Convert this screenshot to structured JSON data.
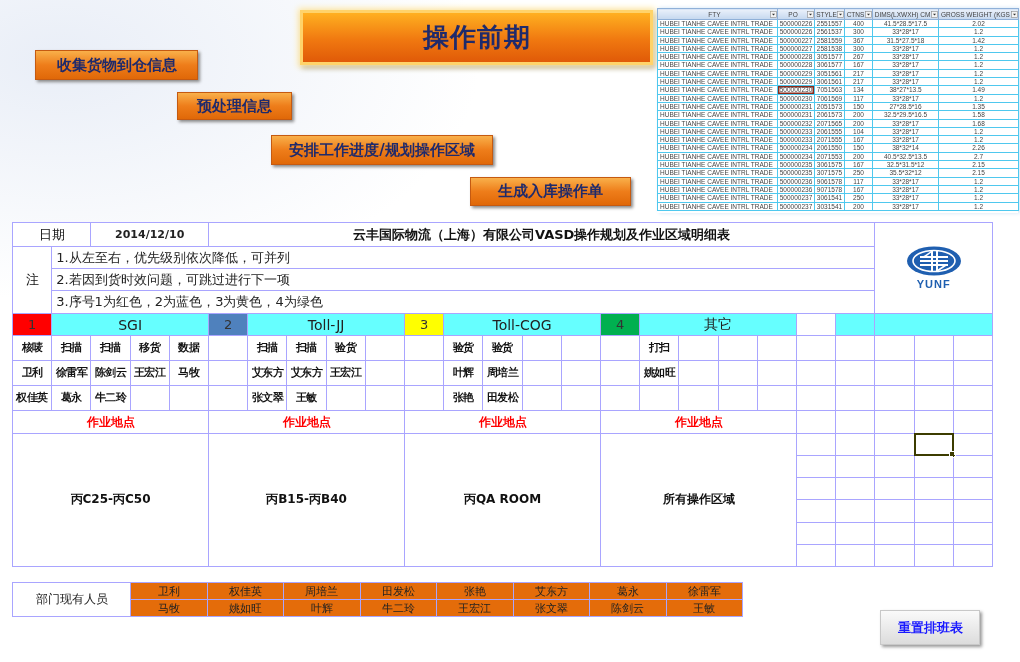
{
  "title_banner": "操作前期",
  "action_buttons": [
    "收集货物到仓信息",
    "预处理信息",
    "安排工作进度/规划操作区域",
    "生成入库操作单"
  ],
  "shipment_table": {
    "columns": [
      "FTY",
      "PO",
      "STYLE",
      "CTNS",
      "DIMS(LXWXH) CM",
      "GROSS WEIGHT (KGS"
    ],
    "rows": [
      {
        "cells": [
          "HUBEI TIANHE CAVEE INTRL TRADE",
          "500000226",
          "2551557",
          "400",
          "41.5*28.5*17.5",
          "2.02"
        ],
        "po_selected": false
      },
      {
        "cells": [
          "HUBEI TIANHE CAVEE INTRL TRADE",
          "500000226",
          "2561537",
          "300",
          "33*28*17",
          "1.2"
        ],
        "po_selected": false
      },
      {
        "cells": [
          "HUBEI TIANHE CAVEE INTRL TRADE",
          "500000227",
          "2581559",
          "367",
          "31.5*27.5*18",
          "1.42"
        ],
        "po_selected": false
      },
      {
        "cells": [
          "HUBEI TIANHE CAVEE INTRL TRADE",
          "500000227",
          "2581538",
          "300",
          "33*28*17",
          "1.2"
        ],
        "po_selected": false
      },
      {
        "cells": [
          "HUBEI TIANHE CAVEE INTRL TRADE",
          "500000228",
          "3051577",
          "267",
          "33*28*17",
          "1.2"
        ],
        "po_selected": false
      },
      {
        "cells": [
          "HUBEI TIANHE CAVEE INTRL TRADE",
          "500000228",
          "3061577",
          "167",
          "33*28*17",
          "1.2"
        ],
        "po_selected": false
      },
      {
        "cells": [
          "HUBEI TIANHE CAVEE INTRL TRADE",
          "500000229",
          "3051561",
          "217",
          "33*28*17",
          "1.2"
        ],
        "po_selected": false
      },
      {
        "cells": [
          "HUBEI TIANHE CAVEE INTRL TRADE",
          "500000229",
          "3061561",
          "217",
          "33*28*17",
          "1.2"
        ],
        "po_selected": false
      },
      {
        "cells": [
          "HUBEI TIANHE CAVEE INTRL TRADE",
          "500000230",
          "7051563",
          "134",
          "38*27*13.5",
          "1.49"
        ],
        "po_selected": true
      },
      {
        "cells": [
          "HUBEI TIANHE CAVEE INTRL TRADE",
          "500000230",
          "7061569",
          "117",
          "33*28*17",
          "1.2"
        ],
        "po_selected": false
      },
      {
        "cells": [
          "HUBEI TIANHE CAVEE INTRL TRADE",
          "500000231",
          "2051573",
          "150",
          "27*28.5*16",
          "1.35"
        ],
        "po_selected": false
      },
      {
        "cells": [
          "HUBEI TIANHE CAVEE INTRL TRADE",
          "500000231",
          "2061573",
          "200",
          "32.5*29.5*16.5",
          "1.58"
        ],
        "po_selected": false
      },
      {
        "cells": [
          "HUBEI TIANHE CAVEE INTRL TRADE",
          "500000232",
          "2071565",
          "200",
          "33*28*17",
          "1.68"
        ],
        "po_selected": false
      },
      {
        "cells": [
          "HUBEI TIANHE CAVEE INTRL TRADE",
          "500000233",
          "2061555",
          "104",
          "33*28*17",
          "1.2"
        ],
        "po_selected": false
      },
      {
        "cells": [
          "HUBEI TIANHE CAVEE INTRL TRADE",
          "500000233",
          "2071555",
          "167",
          "33*28*17",
          "1.2"
        ],
        "po_selected": false
      },
      {
        "cells": [
          "HUBEI TIANHE CAVEE INTRL TRADE",
          "500000234",
          "2061550",
          "150",
          "38*32*14",
          "2.26"
        ],
        "po_selected": false
      },
      {
        "cells": [
          "HUBEI TIANHE CAVEE INTRL TRADE",
          "500000234",
          "2071553",
          "200",
          "40.5*32.5*13.5",
          "2.7"
        ],
        "po_selected": false
      },
      {
        "cells": [
          "HUBEI TIANHE CAVEE INTRL TRADE",
          "500000235",
          "3061575",
          "167",
          "32.5*31.5*12",
          "2.15"
        ],
        "po_selected": false
      },
      {
        "cells": [
          "HUBEI TIANHE CAVEE INTRL TRADE",
          "500000235",
          "3071575",
          "250",
          "35.5*32*12",
          "2.15"
        ],
        "po_selected": false
      },
      {
        "cells": [
          "HUBEI TIANHE CAVEE INTRL TRADE",
          "500000236",
          "9061578",
          "117",
          "33*28*17",
          "1.2"
        ],
        "po_selected": false
      },
      {
        "cells": [
          "HUBEI TIANHE CAVEE INTRL TRADE",
          "500000236",
          "9071578",
          "167",
          "33*28*17",
          "1.2"
        ],
        "po_selected": false
      },
      {
        "cells": [
          "HUBEI TIANHE CAVEE INTRL TRADE",
          "500000237",
          "3061541",
          "250",
          "33*28*17",
          "1.2"
        ],
        "po_selected": false
      },
      {
        "cells": [
          "HUBEI TIANHE CAVEE INTRL TRADE",
          "500000237",
          "3031541",
          "200",
          "33*28*17",
          "1.2"
        ],
        "po_selected": false
      }
    ]
  },
  "sheet": {
    "date_label": "日期",
    "date": "2014/12/10",
    "title": "云丰国际物流（上海）有限公司VASD操作规划及作业区域明细表",
    "logo_text": "YUNF",
    "notes_label": "注",
    "notes": [
      "1.从左至右，优先级别依次降低，可并列",
      "2.若因到货时效问题，可跳过进行下一项",
      "3.序号1为红色，2为蓝色，3为黄色，4为绿色"
    ],
    "groups": [
      {
        "number": "1",
        "color": "#ff0000",
        "name": "SGI",
        "location_label": "作业地点",
        "area": "丙C25-丙C50",
        "slots": [
          {
            "kind": "staff",
            "task": "核唛",
            "people": [
              "卫利",
              "权佳英"
            ]
          },
          {
            "kind": "staff",
            "task": "扫描",
            "people": [
              "徐雷军",
              "葛永"
            ]
          },
          {
            "kind": "staff",
            "task": "扫描",
            "people": [
              "陈剑云",
              "牛二玲"
            ]
          },
          {
            "kind": "staff",
            "task": "移货",
            "people": [
              "王宏江"
            ]
          },
          {
            "kind": "staff",
            "task": "数据",
            "people": [
              "马牧"
            ]
          }
        ]
      },
      {
        "number": "2",
        "color": "#4f81bd",
        "name": "Toll-JJ",
        "location_label": "作业地点",
        "area": "丙B15-丙B40",
        "slots": [
          {
            "kind": "empty"
          },
          {
            "kind": "staff",
            "task": "扫描",
            "people": [
              "艾东方",
              "张文翠"
            ]
          },
          {
            "kind": "staff",
            "task": "扫描",
            "people": [
              "艾东方",
              "王敏"
            ]
          },
          {
            "kind": "staff",
            "task": "验货",
            "people": [
              "王宏江"
            ]
          },
          {
            "kind": "empty"
          }
        ]
      },
      {
        "number": "3",
        "color": "#ffff00",
        "name": "Toll-COG",
        "location_label": "作业地点",
        "area": "丙QA ROOM",
        "slots": [
          {
            "kind": "empty"
          },
          {
            "kind": "staff",
            "task": "验货",
            "people": [
              "叶辉",
              "张艳"
            ]
          },
          {
            "kind": "staff",
            "task": "验货",
            "people": [
              "周培兰",
              "田发松"
            ]
          },
          {
            "kind": "empty"
          },
          {
            "kind": "empty"
          }
        ]
      },
      {
        "number": "4",
        "color": "#00b050",
        "name": "其它",
        "location_label": "作业地点",
        "area": "所有操作区域",
        "slots": [
          {
            "kind": "empty"
          },
          {
            "kind": "staff",
            "task": "打扫",
            "people": [
              "姚如旺"
            ]
          },
          {
            "kind": "empty"
          },
          {
            "kind": "empty"
          },
          {
            "kind": "empty"
          }
        ]
      }
    ],
    "spare_grid": [
      [
        false,
        false,
        false,
        true,
        false
      ],
      [
        false,
        false,
        false,
        false,
        false
      ],
      [
        false,
        false,
        false,
        false,
        false
      ],
      [
        false,
        false,
        false,
        false,
        false
      ],
      [
        false,
        false,
        false,
        false,
        false
      ],
      [
        false,
        false,
        false,
        false,
        false
      ]
    ]
  },
  "staff_pool": {
    "label": "部门现有人员",
    "names": [
      "卫利",
      "权佳英",
      "周培兰",
      "田发松",
      "张艳",
      "艾东方",
      "葛永",
      "徐雷军",
      "马牧",
      "姚如旺",
      "叶辉",
      "牛二玲",
      "王宏江",
      "张文翠",
      "陈剑云",
      "王敏"
    ]
  },
  "reset_button": "重置排班表"
}
